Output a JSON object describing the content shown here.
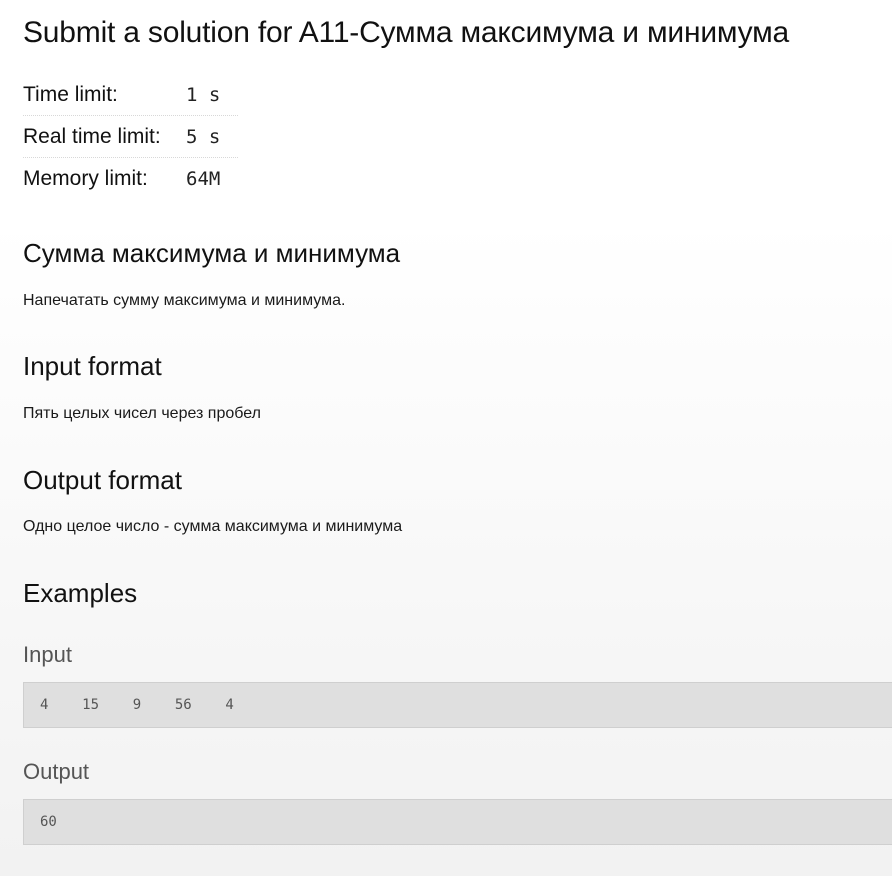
{
  "page": {
    "title": "Submit a solution for A11-Сумма максимума и минимума"
  },
  "limits": [
    {
      "label": "Time limit:",
      "value": "1 s"
    },
    {
      "label": "Real time limit:",
      "value": "5 s"
    },
    {
      "label": "Memory limit:",
      "value": "64M"
    }
  ],
  "problem": {
    "name": "Сумма максимума и минимума",
    "statement": "Напечатать сумму максимума и минимума."
  },
  "input_format": {
    "heading": "Input format",
    "text": "Пять целых чисел через пробел"
  },
  "output_format": {
    "heading": "Output format",
    "text": "Одно целое число - сумма максимума и минимума"
  },
  "examples": {
    "heading": "Examples",
    "input_label": "Input",
    "input_value": "4    15    9    56    4",
    "output_label": "Output",
    "output_value": "60"
  }
}
